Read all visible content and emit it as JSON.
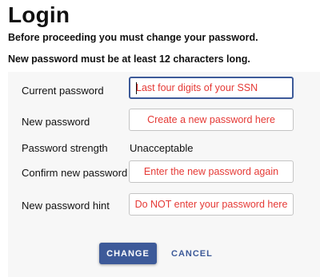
{
  "header": {
    "title": "Login",
    "subtitle": "Before proceeding you must change your password.",
    "requirement": "New password must be at least 12 characters long."
  },
  "form": {
    "current_password": {
      "label": "Current password",
      "placeholder": "Last four digits of your SSN",
      "value": ""
    },
    "new_password": {
      "label": "New password",
      "placeholder": "Create a new password here",
      "value": ""
    },
    "strength": {
      "label": "Password strength",
      "value": "Unacceptable"
    },
    "confirm_password": {
      "label": "Confirm new password",
      "placeholder": "Enter the new password again",
      "value": ""
    },
    "hint": {
      "label": "New password hint",
      "placeholder": "Do NOT enter your password here",
      "value": ""
    }
  },
  "actions": {
    "change_label": "CHANGE",
    "cancel_label": "CANCEL"
  },
  "colors": {
    "accent": "#3d5a99",
    "placeholder": "#e53935",
    "panel": "#f7f7f7"
  }
}
